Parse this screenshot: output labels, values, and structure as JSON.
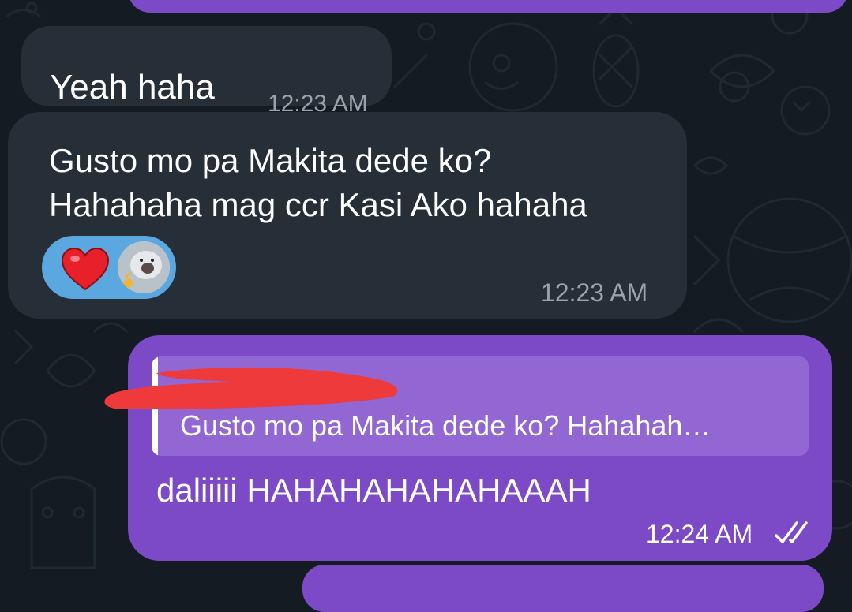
{
  "messages": [
    {
      "id": "msg1",
      "direction": "incoming",
      "text": "Yeah haha",
      "time": "12:23 AM"
    },
    {
      "id": "msg2",
      "direction": "incoming",
      "text_lines": [
        "Gusto mo pa Makita dede ko?",
        "Hahahaha mag ccr Kasi Ako hahaha"
      ],
      "time": "12:23 AM",
      "reactions": [
        {
          "emoji": "❤️",
          "icon": "heart-icon"
        },
        {
          "icon": "reaction-user-avatar"
        }
      ]
    },
    {
      "id": "msg3",
      "direction": "outgoing",
      "reply_to": {
        "author": "",
        "text": "Gusto mo pa Makita dede ko? Hahahah…"
      },
      "text": "daliiiii HAHAHAHAHAHAAAH",
      "time": "12:24 AM",
      "status_icon": "double-check-icon"
    }
  ],
  "colors": {
    "background": "#141b22",
    "incoming_bubble": "#262f38",
    "outgoing_bubble": "#7d4ac7",
    "reply_quote": "#9267d4",
    "reaction_pill": "#5aa8df",
    "timestamp_incoming": "#9aa3ab",
    "redaction": "#ee3a3a"
  }
}
